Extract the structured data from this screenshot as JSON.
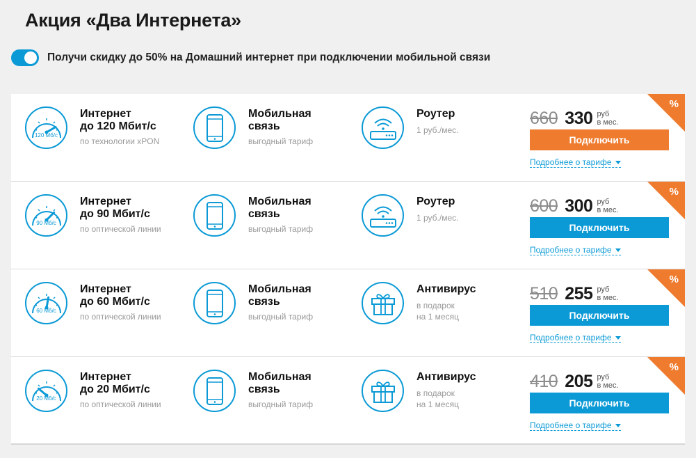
{
  "page": {
    "title": "Акция «Два Интернета»",
    "toggle_label": "Получи скидку до 50% на Домашний интернет при подключении мобильной связи",
    "toggle_on": true
  },
  "colors": {
    "accent": "#0b9ad6",
    "promo": "#ef7b2e"
  },
  "cards": [
    {
      "internet_title": "Интернет",
      "internet_speed": "до 120 Мбит/с",
      "internet_sub": "по технологии xPON",
      "speed_icon_caption": "120 Мб/с",
      "mobile_title_1": "Мобильная",
      "mobile_title_2": "связь",
      "mobile_sub": "выгодный тариф",
      "extra_icon": "router-icon",
      "extra_title": "Роутер",
      "extra_sub_1": "1 руб./мес.",
      "extra_sub_2": "",
      "old_price": "660",
      "new_price": "330",
      "unit_1": "руб",
      "unit_2": "в мес.",
      "button_label": "Подключить",
      "button_color": "orange",
      "more_label": "Подробнее о тарифе",
      "badge": "%"
    },
    {
      "internet_title": "Интернет",
      "internet_speed": "до 90 Мбит/с",
      "internet_sub": "по оптической линии",
      "speed_icon_caption": "90 Мб/с",
      "mobile_title_1": "Мобильная",
      "mobile_title_2": "связь",
      "mobile_sub": "выгодный тариф",
      "extra_icon": "router-icon",
      "extra_title": "Роутер",
      "extra_sub_1": "1 руб./мес.",
      "extra_sub_2": "",
      "old_price": "600",
      "new_price": "300",
      "unit_1": "руб",
      "unit_2": "в мес.",
      "button_label": "Подключить",
      "button_color": "blue",
      "more_label": "Подробнее о тарифе",
      "badge": "%"
    },
    {
      "internet_title": "Интернет",
      "internet_speed": "до 60 Мбит/с",
      "internet_sub": "по оптической линии",
      "speed_icon_caption": "60 Мб/с",
      "mobile_title_1": "Мобильная",
      "mobile_title_2": "связь",
      "mobile_sub": "выгодный тариф",
      "extra_icon": "gift-icon",
      "extra_title": "Антивирус",
      "extra_sub_1": "в подарок",
      "extra_sub_2": "на 1 месяц",
      "old_price": "510",
      "new_price": "255",
      "unit_1": "руб",
      "unit_2": "в мес.",
      "button_label": "Подключить",
      "button_color": "blue",
      "more_label": "Подробнее о тарифе",
      "badge": "%"
    },
    {
      "internet_title": "Интернет",
      "internet_speed": "до 20 Мбит/с",
      "internet_sub": "по оптической линии",
      "speed_icon_caption": "20 Мб/с",
      "mobile_title_1": "Мобильная",
      "mobile_title_2": "связь",
      "mobile_sub": "выгодный тариф",
      "extra_icon": "gift-icon",
      "extra_title": "Антивирус",
      "extra_sub_1": "в подарок",
      "extra_sub_2": "на 1 месяц",
      "old_price": "410",
      "new_price": "205",
      "unit_1": "руб",
      "unit_2": "в мес.",
      "button_label": "Подключить",
      "button_color": "blue",
      "more_label": "Подробнее о тарифе",
      "badge": "%"
    }
  ]
}
